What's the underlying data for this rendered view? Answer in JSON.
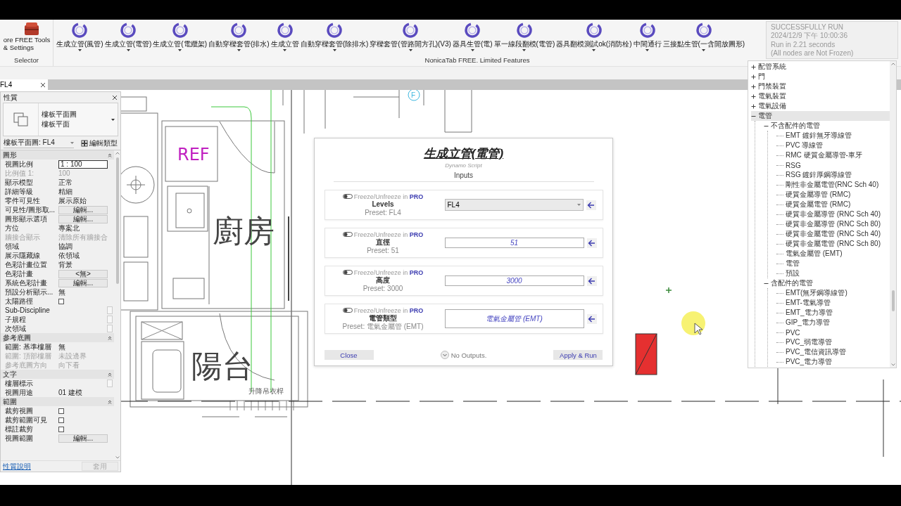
{
  "ribbon": {
    "selector_button": {
      "label_lines": [
        "ore FREE Tools",
        "& Settings"
      ]
    },
    "selector_group": "Selector",
    "buttons": [
      {
        "label": "生成立管(風管)"
      },
      {
        "label": "生成立管(電管)"
      },
      {
        "label": "生成立管(電纜架)"
      },
      {
        "label": "自動穿樑套管(排水)"
      },
      {
        "label": "生成立管"
      },
      {
        "label": "自動穿樑套管(除排水)"
      },
      {
        "label": "穿樑套管(管路開方孔)(V3)"
      },
      {
        "label": "器具生管(電)"
      },
      {
        "label": "單一線段翻模(電管)"
      },
      {
        "label": "器具翻模測試ok(消防栓)"
      },
      {
        "label": "中間通行"
      },
      {
        "label": "三接點生管(一含開放圖形)"
      }
    ],
    "group_label": "NonicaTab FREE. Limited Features"
  },
  "toast": {
    "lines": [
      "SUCCESSFULLY RUN",
      "2024/12/9 下午 10:00:36",
      "Run in 2.21 seconds",
      "(All nodes are Not Frozen)"
    ]
  },
  "view_tab": {
    "label": "FL4",
    "selected": true
  },
  "properties": {
    "title": "性質",
    "type_lines": [
      "樓板平面圖",
      "樓板平面"
    ],
    "view_selector": "樓板平面圖: FL4",
    "edit_type": "編輯類型",
    "sections": [
      {
        "title": "圖形",
        "expanded": true,
        "rows": [
          {
            "label": "視圖比例",
            "value": "1 : 100",
            "kind": "input",
            "disabled": false
          },
          {
            "label": "比例值 1:",
            "value": "100",
            "kind": "text",
            "disabled": true
          },
          {
            "label": "顯示模型",
            "value": "正常",
            "kind": "text",
            "disabled": false
          },
          {
            "label": "詳細等級",
            "value": "精細",
            "kind": "text",
            "disabled": false
          },
          {
            "label": "零件可見性",
            "value": "展示原始",
            "kind": "text",
            "disabled": false
          },
          {
            "label": "可見性/圖形取...",
            "value": "編輯...",
            "kind": "button",
            "disabled": false
          },
          {
            "label": "圖形顯示選項",
            "value": "編輯...",
            "kind": "button",
            "disabled": false
          },
          {
            "label": "方位",
            "value": "專案北",
            "kind": "text",
            "disabled": false
          },
          {
            "label": "牆接合顯示",
            "value": "清除所有牆接合",
            "kind": "text",
            "disabled": true
          },
          {
            "label": "領域",
            "value": "協調",
            "kind": "text",
            "disabled": false
          },
          {
            "label": "展示隱藏線",
            "value": "依領域",
            "kind": "text",
            "disabled": false
          },
          {
            "label": "色彩計畫位置",
            "value": "背景",
            "kind": "text",
            "disabled": false
          },
          {
            "label": "色彩計畫",
            "value": "<無>",
            "kind": "button",
            "disabled": false
          },
          {
            "label": "系統色彩計畫",
            "value": "編輯...",
            "kind": "button",
            "disabled": false
          },
          {
            "label": "預設分析顯示...",
            "value": "無",
            "kind": "text",
            "disabled": false
          },
          {
            "label": "太陽路徑",
            "kind": "checkbox",
            "checked": false,
            "disabled": false
          },
          {
            "label": "Sub-Discipline",
            "kind": "blank",
            "disabled": false
          },
          {
            "label": "子規程",
            "kind": "blank",
            "disabled": false
          },
          {
            "label": "次領域",
            "kind": "blank",
            "disabled": false
          }
        ]
      },
      {
        "title": "參考底圖",
        "expanded": true,
        "rows": [
          {
            "label": "範圍: 基準樓層",
            "value": "無",
            "kind": "text",
            "disabled": false
          },
          {
            "label": "範圍: 頂部樓層",
            "value": "未設邊界",
            "kind": "text",
            "disabled": true
          },
          {
            "label": "參考底圖方向",
            "value": "向下看",
            "kind": "text",
            "disabled": true
          }
        ]
      },
      {
        "title": "文字",
        "expanded": true,
        "rows": [
          {
            "label": "樓層標示",
            "kind": "blank",
            "disabled": false
          },
          {
            "label": "視圖用途",
            "value": "01 建模",
            "kind": "text",
            "disabled": false
          }
        ]
      },
      {
        "title": "範圍",
        "expanded": true,
        "rows": [
          {
            "label": "裁剪視圖",
            "kind": "checkbox",
            "checked": false,
            "disabled": false
          },
          {
            "label": "裁剪範圍可見",
            "kind": "checkbox",
            "checked": false,
            "disabled": false
          },
          {
            "label": "標註裁剪",
            "kind": "checkbox",
            "checked": false,
            "disabled": false
          },
          {
            "label": "視圖範圍",
            "value": "編輯...",
            "kind": "button",
            "disabled": false
          }
        ]
      }
    ],
    "help_link": "性質說明",
    "apply_button": {
      "label": "套用",
      "disabled": true
    }
  },
  "canvas": {
    "grid_label": "F",
    "room_labels": [
      {
        "text": "REF",
        "kind": "tag"
      },
      {
        "text": "廚房",
        "kind": "room"
      },
      {
        "text": "陽台",
        "kind": "room"
      },
      {
        "text": "升降吊衣桿",
        "kind": "note"
      }
    ]
  },
  "dialog": {
    "title": "生成立管(電管)",
    "subtitle": "Dynamo Script",
    "section": "Inputs",
    "inputs": [
      {
        "freeze_text": "Freeze/Unfreeze in ",
        "pro": "PRO",
        "frozen": false,
        "name": "Levels",
        "preset": "Preset: FL4",
        "value": "FL4",
        "kind": "dropdown"
      },
      {
        "freeze_text": "Freeze/Unfreeze in ",
        "pro": "PRO",
        "frozen": false,
        "name": "直徑",
        "preset": "Preset: 51",
        "value": "51",
        "kind": "field"
      },
      {
        "freeze_text": "Freeze/Unfreeze in ",
        "pro": "PRO",
        "frozen": false,
        "name": "高度",
        "preset": "Preset: 3000",
        "value": "3000",
        "kind": "field"
      },
      {
        "freeze_text": "Freeze/Unfreeze in ",
        "pro": "PRO",
        "frozen": false,
        "name": "電管類型",
        "preset": "Preset: 電氣金屬管 (EMT)",
        "value": "電氣金屬管 (EMT)",
        "kind": "field"
      }
    ],
    "close": "Close",
    "outputs": "No Outputs.",
    "apply": "Apply & Run"
  },
  "tree": {
    "items": [
      {
        "label": "配管系統",
        "expanded": false,
        "selected": false
      },
      {
        "label": "門",
        "expanded": false,
        "selected": false
      },
      {
        "label": "門禁裝置",
        "expanded": false,
        "selected": false
      },
      {
        "label": "電氣裝置",
        "expanded": false,
        "selected": false
      },
      {
        "label": "電氣設備",
        "expanded": false,
        "selected": false
      },
      {
        "label": "電管",
        "expanded": true,
        "selected": true,
        "children": [
          {
            "label": "不含配件的電管",
            "expanded": true,
            "selected": false,
            "children": [
              {
                "label": "EMT 鍍鋅無牙導線管",
                "selected": false
              },
              {
                "label": "PVC 導線管",
                "selected": false
              },
              {
                "label": "RMC 硬質金屬導管-車牙",
                "selected": false
              },
              {
                "label": "RSG",
                "selected": false
              },
              {
                "label": "RSG 鍍鋅厚鋼導線管",
                "selected": false
              },
              {
                "label": "剛性非金屬電管(RNC Sch 40)",
                "selected": false
              },
              {
                "label": "硬質金屬導管 (RMC)",
                "selected": false
              },
              {
                "label": "硬質金屬電管 (RMC)",
                "selected": false
              },
              {
                "label": "硬質非金屬導管 (RNC Sch 40)",
                "selected": false
              },
              {
                "label": "硬質非金屬導管 (RNC Sch 80)",
                "selected": false
              },
              {
                "label": "硬質非金屬電管 (RNC Sch 40)",
                "selected": false
              },
              {
                "label": "硬質非金屬電管 (RNC Sch 80)",
                "selected": false
              },
              {
                "label": "電氣金屬管 (EMT)",
                "selected": false
              },
              {
                "label": "電管",
                "selected": false
              },
              {
                "label": "預設",
                "selected": false
              }
            ]
          },
          {
            "label": "含配件的電管",
            "expanded": true,
            "selected": false,
            "children": [
              {
                "label": "EMT(無牙鋼導線管)",
                "selected": false
              },
              {
                "label": "EMT-電氣導管",
                "selected": false
              },
              {
                "label": "EMT_電力導管",
                "selected": false
              },
              {
                "label": "GIP_電力導管",
                "selected": false
              },
              {
                "label": "PVC",
                "selected": false
              },
              {
                "label": "PVC_弱電導管",
                "selected": false
              },
              {
                "label": "PVC_電信資訊導管",
                "selected": false
              },
              {
                "label": "PVC_電力導管",
                "selected": false
              }
            ]
          }
        ]
      }
    ]
  }
}
